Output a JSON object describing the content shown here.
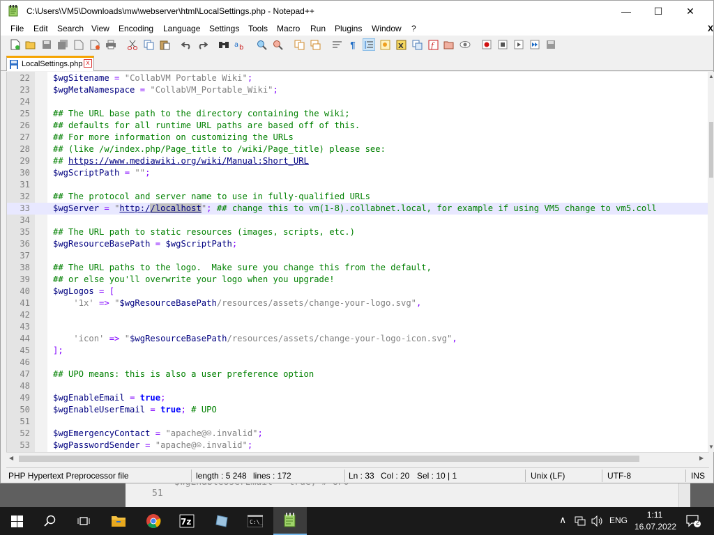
{
  "window": {
    "title": "C:\\Users\\VM5\\Downloads\\mw\\webserver\\html\\LocalSettings.php - Notepad++",
    "minimize": "—",
    "maximize": "☐",
    "close": "✕"
  },
  "menu": [
    "File",
    "Edit",
    "Search",
    "View",
    "Encoding",
    "Language",
    "Settings",
    "Tools",
    "Macro",
    "Run",
    "Plugins",
    "Window",
    "?"
  ],
  "menu_close": "X",
  "tab": {
    "label": "LocalSettings.php",
    "close": "x"
  },
  "lines": [
    {
      "n": "22",
      "code": [
        [
          "v",
          "$wgSitename"
        ],
        [
          "o",
          " = "
        ],
        [
          "s",
          "\"CollabVM Portable Wiki\""
        ],
        [
          "o",
          ";"
        ]
      ]
    },
    {
      "n": "23",
      "code": [
        [
          "v",
          "$wgMetaNamespace"
        ],
        [
          "o",
          " = "
        ],
        [
          "s",
          "\"CollabVM_Portable_Wiki\""
        ],
        [
          "o",
          ";"
        ]
      ]
    },
    {
      "n": "24",
      "code": []
    },
    {
      "n": "25",
      "code": [
        [
          "c",
          "## The URL base path to the directory containing the wiki;"
        ]
      ]
    },
    {
      "n": "26",
      "code": [
        [
          "c",
          "## defaults for all runtime URL paths are based off of this."
        ]
      ]
    },
    {
      "n": "27",
      "code": [
        [
          "c",
          "## For more information on customizing the URLs"
        ]
      ]
    },
    {
      "n": "28",
      "code": [
        [
          "c",
          "## (like /w/index.php/Page_title to /wiki/Page_title) please see:"
        ]
      ]
    },
    {
      "n": "29",
      "code": [
        [
          "c",
          "## "
        ],
        [
          "u",
          "https://www.mediawiki.org/wiki/Manual:Short_URL"
        ]
      ]
    },
    {
      "n": "30",
      "code": [
        [
          "v",
          "$wgScriptPath"
        ],
        [
          "o",
          " = "
        ],
        [
          "s",
          "\"\""
        ],
        [
          "o",
          ";"
        ]
      ]
    },
    {
      "n": "31",
      "code": []
    },
    {
      "n": "32",
      "code": [
        [
          "c",
          "## The protocol and server name to use in fully-qualified URLs"
        ]
      ]
    },
    {
      "n": "33",
      "cur": true,
      "code": [
        [
          "v",
          "$wgServer"
        ],
        [
          "o",
          " = "
        ],
        [
          "s",
          "\""
        ],
        [
          "u",
          "http:/"
        ],
        [
          "u sel",
          "/localhost"
        ],
        [
          "s",
          "\""
        ],
        [
          "o",
          "; "
        ],
        [
          "c",
          "## change this to vm(1-8).collabnet.local, for example if using VM5 change to vm5.coll"
        ]
      ]
    },
    {
      "n": "34",
      "code": []
    },
    {
      "n": "35",
      "code": [
        [
          "c",
          "## The URL path to static resources (images, scripts, etc.)"
        ]
      ]
    },
    {
      "n": "36",
      "code": [
        [
          "v",
          "$wgResourceBasePath"
        ],
        [
          "o",
          " = "
        ],
        [
          "v",
          "$wgScriptPath"
        ],
        [
          "o",
          ";"
        ]
      ]
    },
    {
      "n": "37",
      "code": []
    },
    {
      "n": "38",
      "code": [
        [
          "c",
          "## The URL paths to the logo.  Make sure you change this from the default,"
        ]
      ]
    },
    {
      "n": "39",
      "code": [
        [
          "c",
          "## or else you'll overwrite your logo when you upgrade!"
        ]
      ]
    },
    {
      "n": "40",
      "code": [
        [
          "v",
          "$wgLogos"
        ],
        [
          "o",
          " = ["
        ]
      ]
    },
    {
      "n": "41",
      "code": [
        [
          "s",
          "    '1x'"
        ],
        [
          "o",
          " => "
        ],
        [
          "s",
          "\""
        ],
        [
          "v",
          "$wgResourceBasePath"
        ],
        [
          "s",
          "/resources/assets/change-your-logo.svg\""
        ],
        [
          "o",
          ","
        ]
      ]
    },
    {
      "n": "42",
      "code": []
    },
    {
      "n": "43",
      "code": []
    },
    {
      "n": "44",
      "code": [
        [
          "s",
          "    'icon'"
        ],
        [
          "o",
          " => "
        ],
        [
          "s",
          "\""
        ],
        [
          "v",
          "$wgResourceBasePath"
        ],
        [
          "s",
          "/resources/assets/change-your-logo-icon.svg\""
        ],
        [
          "o",
          ","
        ]
      ]
    },
    {
      "n": "45",
      "code": [
        [
          "o",
          "];"
        ]
      ]
    },
    {
      "n": "46",
      "code": []
    },
    {
      "n": "47",
      "code": [
        [
          "c",
          "## UPO means: this is also a user preference option"
        ]
      ]
    },
    {
      "n": "48",
      "code": []
    },
    {
      "n": "49",
      "code": [
        [
          "v",
          "$wgEnableEmail"
        ],
        [
          "o",
          " = "
        ],
        [
          "k",
          "true"
        ],
        [
          "o",
          ";"
        ]
      ]
    },
    {
      "n": "50",
      "code": [
        [
          "v",
          "$wgEnableUserEmail"
        ],
        [
          "o",
          " = "
        ],
        [
          "k",
          "true"
        ],
        [
          "o",
          "; "
        ],
        [
          "c",
          "# UPO"
        ]
      ]
    },
    {
      "n": "51",
      "code": []
    },
    {
      "n": "52",
      "code": [
        [
          "v",
          "$wgEmergencyContact"
        ],
        [
          "o",
          " = "
        ],
        [
          "s",
          "\"apache@☺.invalid\""
        ],
        [
          "o",
          ";"
        ]
      ]
    },
    {
      "n": "53",
      "code": [
        [
          "v",
          "$wgPasswordSender"
        ],
        [
          "o",
          " = "
        ],
        [
          "s",
          "\"apache@☺.invalid\""
        ],
        [
          "o",
          ";"
        ]
      ]
    }
  ],
  "status": {
    "filetype": "PHP Hypertext Preprocessor file",
    "length": "length : 5 248",
    "lines": "lines : 172",
    "ln": "Ln : 33",
    "col": "Col : 20",
    "sel": "Sel : 10 | 1",
    "eol": "Unix (LF)",
    "encoding": "UTF-8",
    "mode": "INS"
  },
  "behind_window": {
    "line_number": "51",
    "text": "$wgEnableUserEmail = true; # UPO"
  },
  "tray": {
    "lang": "ENG",
    "time": "1:11",
    "date": "16.07.2022",
    "notifications": "2"
  },
  "colors": {
    "accent": "#f6a400",
    "comment": "#008000",
    "string": "#808080",
    "keyword": "#0000ff",
    "variable": "#000080",
    "taskbar": "#1a1a1a"
  }
}
